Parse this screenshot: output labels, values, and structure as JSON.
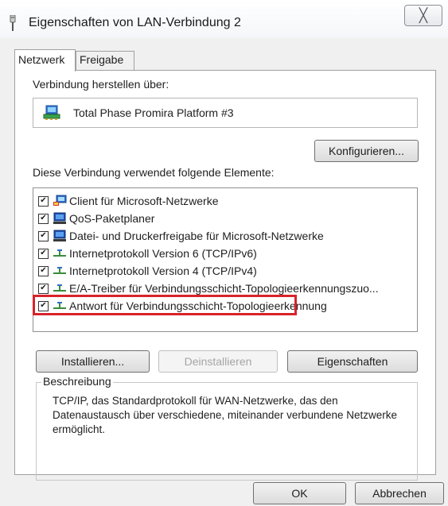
{
  "window": {
    "title": "Eigenschaften von LAN-Verbindung 2",
    "close_glyph": "╳"
  },
  "tabs": [
    {
      "label": "Netzwerk",
      "active": true
    },
    {
      "label": "Freigabe",
      "active": false
    }
  ],
  "connect_using": {
    "label": "Verbindung herstellen über:",
    "adapter": "Total Phase Promira Platform #3",
    "adapter_icon": "network-adapter-icon"
  },
  "buttons": {
    "configure": "Konfigurieren...",
    "install": "Installieren...",
    "uninstall": "Deinstallieren",
    "properties": "Eigenschaften",
    "ok": "OK",
    "cancel": "Abbrechen"
  },
  "items_label": "Diese Verbindung verwendet folgende Elemente:",
  "items": [
    {
      "label": "Client für Microsoft-Netzwerke",
      "checked": true,
      "icon": "client-network-icon"
    },
    {
      "label": "QoS-Paketplaner",
      "checked": true,
      "icon": "service-monitor-icon"
    },
    {
      "label": "Datei- und Druckerfreigabe für Microsoft-Netzwerke",
      "checked": true,
      "icon": "service-monitor-icon"
    },
    {
      "label": "Internetprotokoll Version 6 (TCP/IPv6)",
      "checked": true,
      "icon": "protocol-icon"
    },
    {
      "label": "Internetprotokoll Version 4 (TCP/IPv4)",
      "checked": true,
      "icon": "protocol-icon",
      "highlighted": true
    },
    {
      "label": "E/A-Treiber für Verbindungsschicht-Topologieerkennungszuo...",
      "checked": true,
      "icon": "protocol-icon"
    },
    {
      "label": "Antwort für Verbindungsschicht-Topologieerkennung",
      "checked": true,
      "icon": "protocol-icon"
    }
  ],
  "description": {
    "title": "Beschreibung",
    "text": "TCP/IP, das Standardprotokoll für WAN-Netzwerke, das den Datenaustausch über verschiedene, miteinander verbundene Netzwerke ermöglicht."
  },
  "colors": {
    "highlight": "#d8232a",
    "dialog_bg": "#f0f0f0"
  }
}
